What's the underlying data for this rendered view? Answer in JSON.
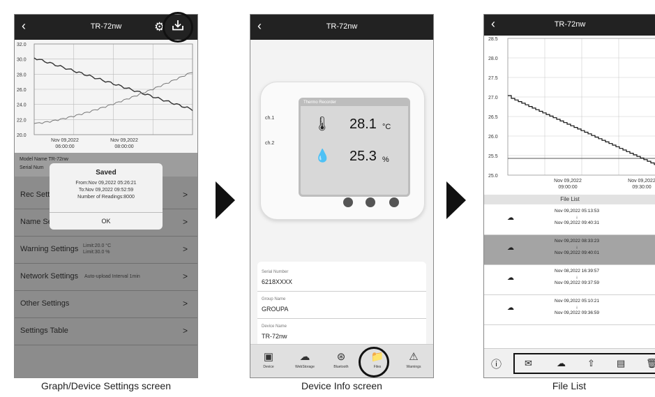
{
  "screen1": {
    "title": "TR-72nw",
    "caption": "Graph/Device Settings screen",
    "y_ticks": [
      "32.0",
      "30.0",
      "28.0",
      "26.0",
      "24.0",
      "22.0",
      "20.0"
    ],
    "x_ticks": [
      [
        "Nov 09,2022",
        "06:00:00"
      ],
      [
        "Nov 09,2022",
        "08:00:00"
      ]
    ],
    "info_lines": [
      "Model Name    TR-72nw",
      "Serial Num"
    ],
    "modal": {
      "title": "Saved",
      "lines": [
        "From:Nov 09,2022 05:26:21",
        "To:Nov 09,2022 09:52:59",
        "Number of Readings:8000"
      ],
      "ok": "OK"
    },
    "rows": [
      {
        "label": "Rec Setti",
        "sub": []
      },
      {
        "label": "Name Se",
        "sub": []
      },
      {
        "label": "Warning Settings",
        "sub": [
          "Limit:20.0 °C",
          "Limit:30.0 %"
        ]
      },
      {
        "label": "Network Settings",
        "sub": [
          "Auto-upload Interval 1min"
        ]
      },
      {
        "label": "Other Settings",
        "sub": []
      },
      {
        "label": "Settings Table",
        "sub": []
      }
    ],
    "chevron": ">"
  },
  "screen2": {
    "title": "TR-72nw",
    "caption": "Device Info screen",
    "device_header": "Thermo Recorder",
    "ch1": "ch.1",
    "ch2": "ch.2",
    "temp": "28.1",
    "temp_unit": "°C",
    "hum": "25.3",
    "hum_unit": "%",
    "fields": [
      {
        "label": "Serial Number",
        "value": "6218XXXX"
      },
      {
        "label": "Group Name",
        "value": "GROUPA"
      },
      {
        "label": "Device Name",
        "value": "TR-72nw"
      }
    ],
    "tabs": [
      "Device",
      "WebStorage",
      "Bluetooth",
      "Files",
      "Warnings"
    ]
  },
  "screen3": {
    "title": "TR-72nw",
    "caption": "File List",
    "y_ticks": [
      "28.5",
      "28.0",
      "27.5",
      "27.0",
      "26.5",
      "26.0",
      "25.5",
      "25.0"
    ],
    "x_ticks": [
      [
        "Nov 09,2022",
        "09:00:00"
      ],
      [
        "Nov 09,2022",
        "09:30:00"
      ]
    ],
    "list_title": "File List",
    "files": [
      {
        "from": "Nov 09,2022 05:13:53",
        "to": "Nov 09,2022 09:40:31",
        "selected": false
      },
      {
        "from": "Nov 09,2022 08:33:23",
        "to": "Nov 09,2022 09:40:01",
        "selected": true
      },
      {
        "from": "Nov 08,2022 16:39:57",
        "to": "Nov 09,2022 09:37:59",
        "selected": false
      },
      {
        "from": "Nov 09,2022 05:10:21",
        "to": "Nov 09,2022 09:36:59",
        "selected": false
      }
    ],
    "arrow_down": "↓"
  }
}
